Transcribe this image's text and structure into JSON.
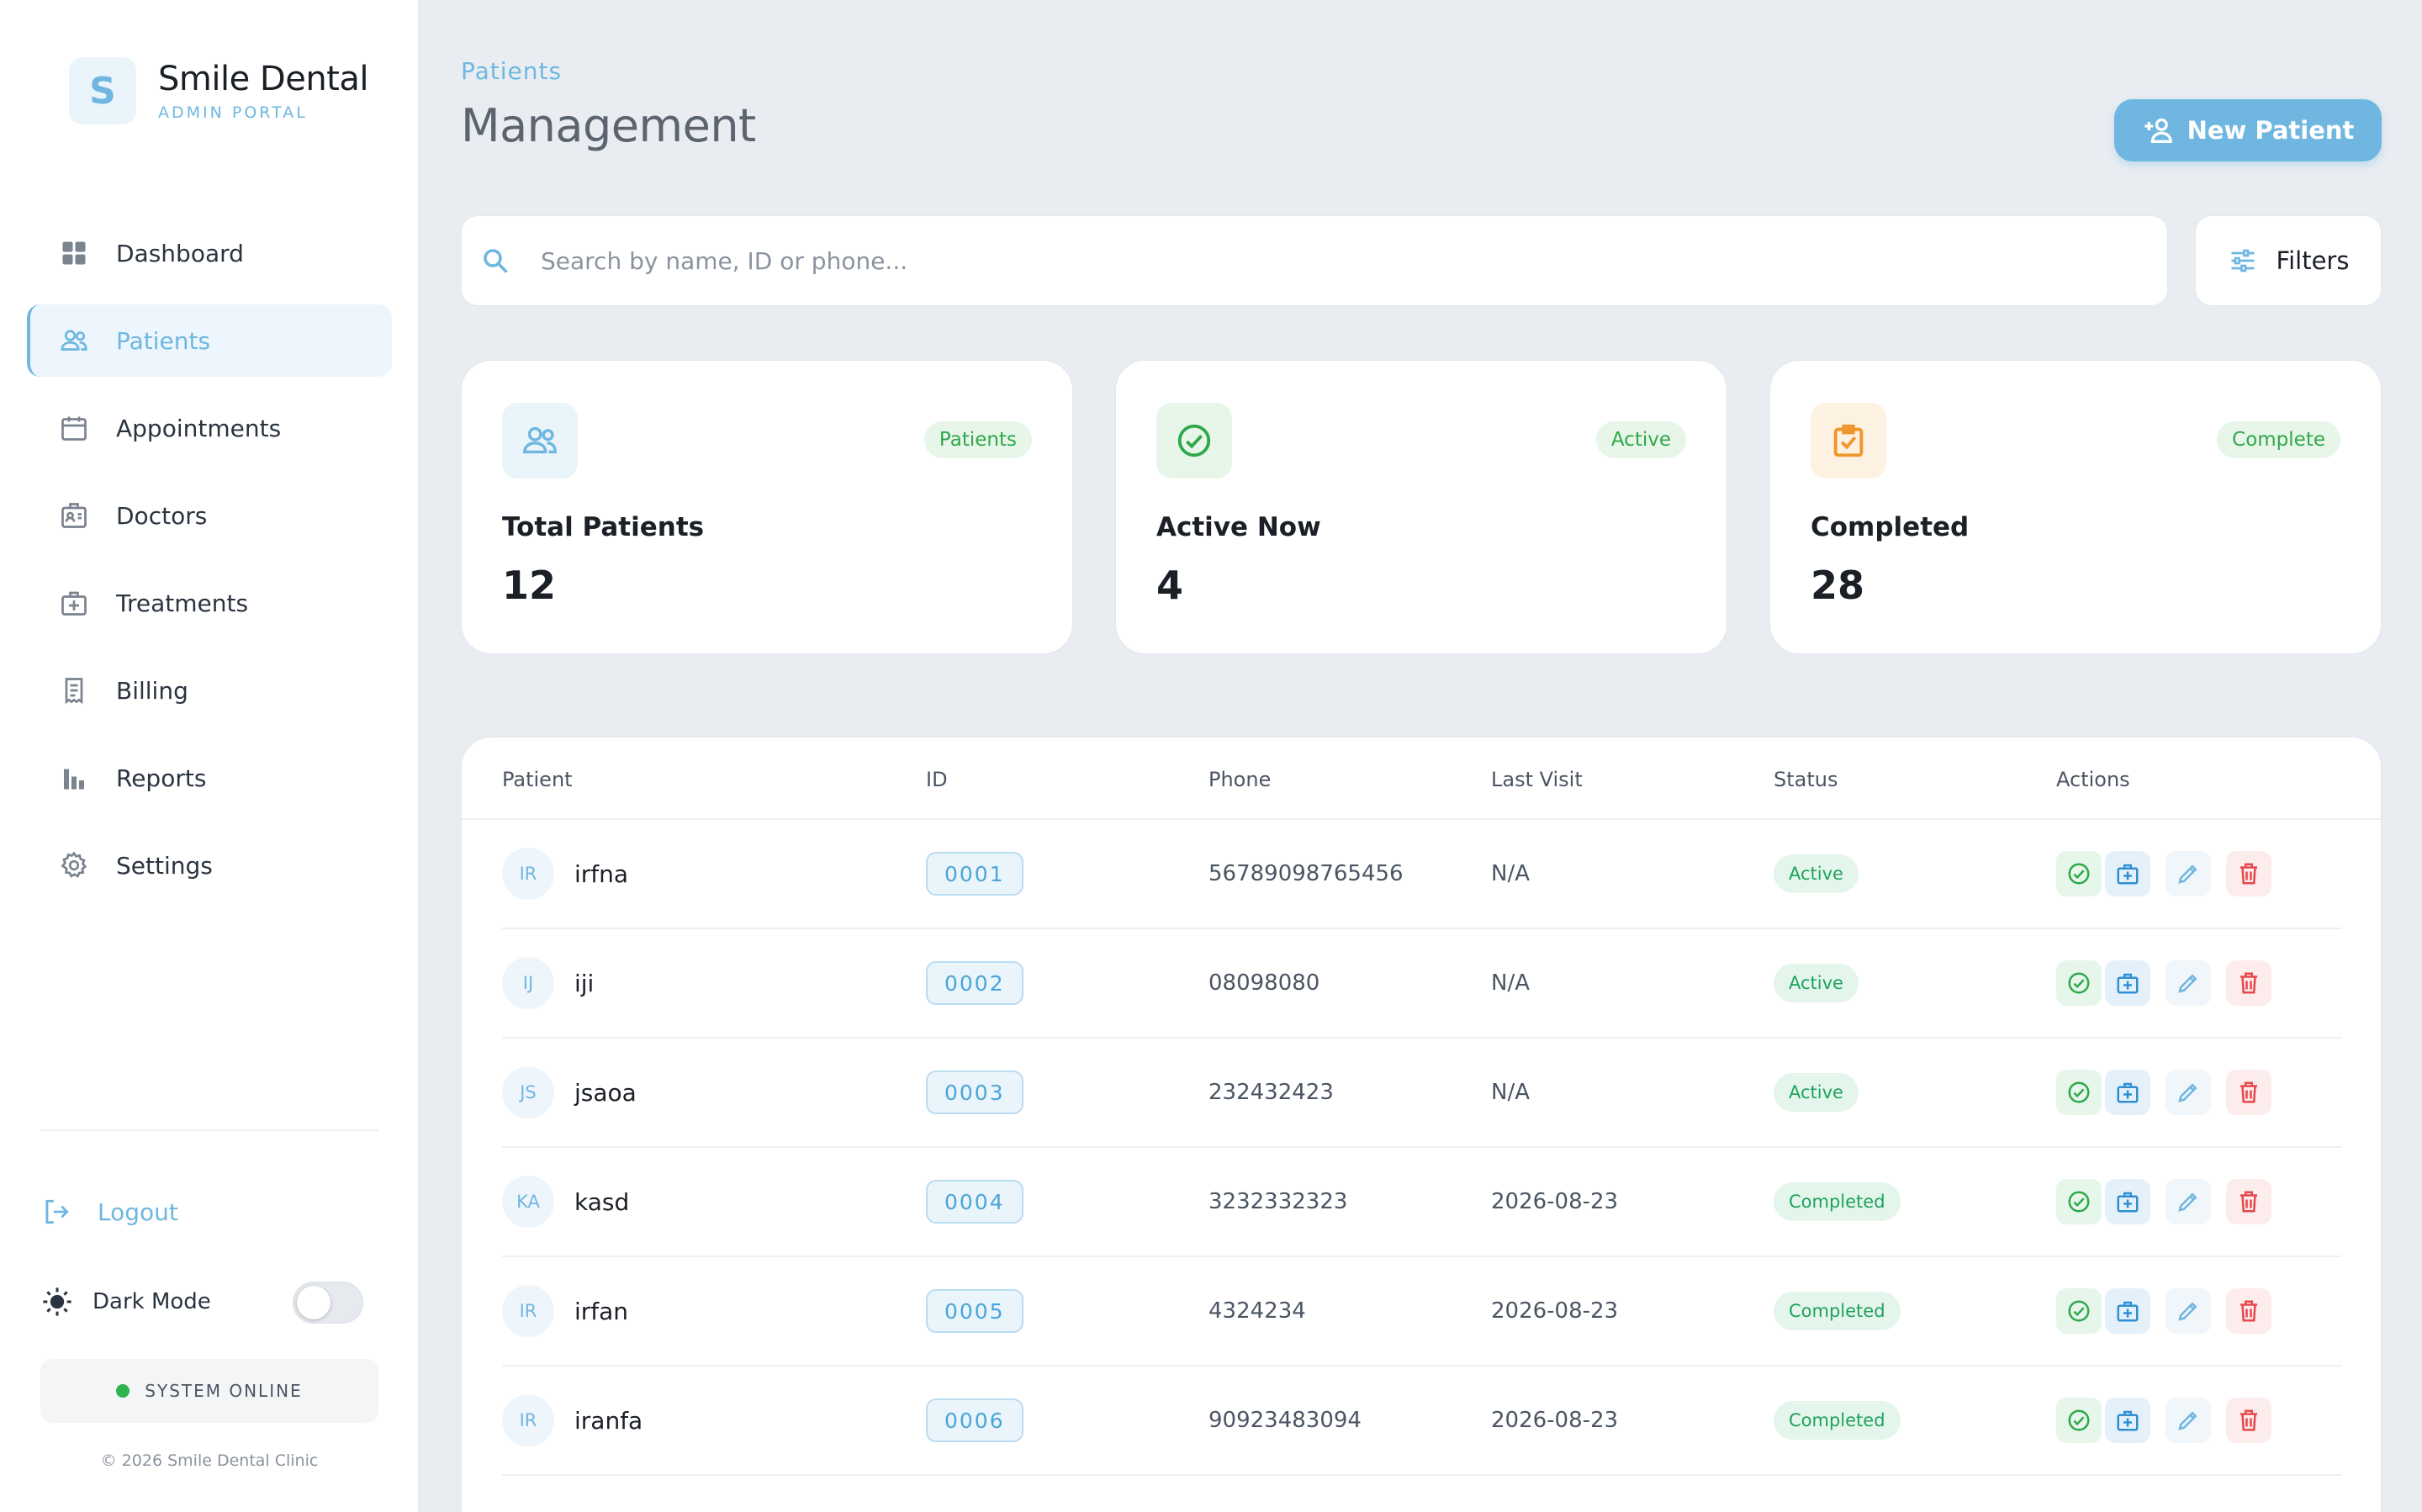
{
  "brand": {
    "logo_letter": "S",
    "name": "Smile Dental",
    "subtitle": "ADMIN PORTAL"
  },
  "nav": {
    "items": [
      {
        "label": "Dashboard",
        "icon": "grid-icon"
      },
      {
        "label": "Patients",
        "icon": "users-icon",
        "active": true
      },
      {
        "label": "Appointments",
        "icon": "calendar-icon"
      },
      {
        "label": "Doctors",
        "icon": "doctor-badge-icon"
      },
      {
        "label": "Treatments",
        "icon": "medical-kit-icon"
      },
      {
        "label": "Billing",
        "icon": "receipt-icon"
      },
      {
        "label": "Reports",
        "icon": "bar-chart-icon"
      },
      {
        "label": "Settings",
        "icon": "gear-icon"
      }
    ],
    "logout": "Logout",
    "dark_mode": "Dark Mode",
    "dark_mode_on": false,
    "system_status": "SYSTEM ONLINE",
    "copyright": "© 2026 Smile Dental Clinic"
  },
  "header": {
    "breadcrumb": "Patients",
    "title": "Management",
    "new_button": "New Patient"
  },
  "search": {
    "placeholder": "Search by name, ID or phone...",
    "value": "",
    "filters_label": "Filters"
  },
  "stats": [
    {
      "badge": "Patients",
      "label": "Total Patients",
      "value": "12",
      "icon": "users-icon",
      "color": "#6fb7e0",
      "bg": "#eaf4fb"
    },
    {
      "badge": "Active",
      "label": "Active Now",
      "value": "4",
      "icon": "check-circle-icon",
      "color": "#2fa84a",
      "bg": "#e8f6ea"
    },
    {
      "badge": "Complete",
      "label": "Completed",
      "value": "28",
      "icon": "clipboard-check-icon",
      "color": "#f0962a",
      "bg": "#fdf1e2"
    }
  ],
  "table": {
    "columns": [
      "Patient",
      "ID",
      "Phone",
      "Last Visit",
      "Status",
      "Actions"
    ],
    "rows": [
      {
        "initials": "IR",
        "name": "irfna",
        "id": "0001",
        "phone": "56789098765456",
        "last_visit": "N/A",
        "status": "Active"
      },
      {
        "initials": "IJ",
        "name": "iji",
        "id": "0002",
        "phone": "08098080",
        "last_visit": "N/A",
        "status": "Active"
      },
      {
        "initials": "JS",
        "name": "jsaoa",
        "id": "0003",
        "phone": "232432423",
        "last_visit": "N/A",
        "status": "Active"
      },
      {
        "initials": "KA",
        "name": "kasd",
        "id": "0004",
        "phone": "3232332323",
        "last_visit": "2026-08-23",
        "status": "Completed"
      },
      {
        "initials": "IR",
        "name": "irfan",
        "id": "0005",
        "phone": "4324234",
        "last_visit": "2026-08-23",
        "status": "Completed"
      },
      {
        "initials": "IR",
        "name": "iranfa",
        "id": "0006",
        "phone": "90923483094",
        "last_visit": "2026-08-23",
        "status": "Completed"
      }
    ]
  },
  "colors": {
    "accent": "#6fb7e0",
    "success": "#2fa84a",
    "danger": "#e5484d",
    "warning": "#f0962a"
  }
}
